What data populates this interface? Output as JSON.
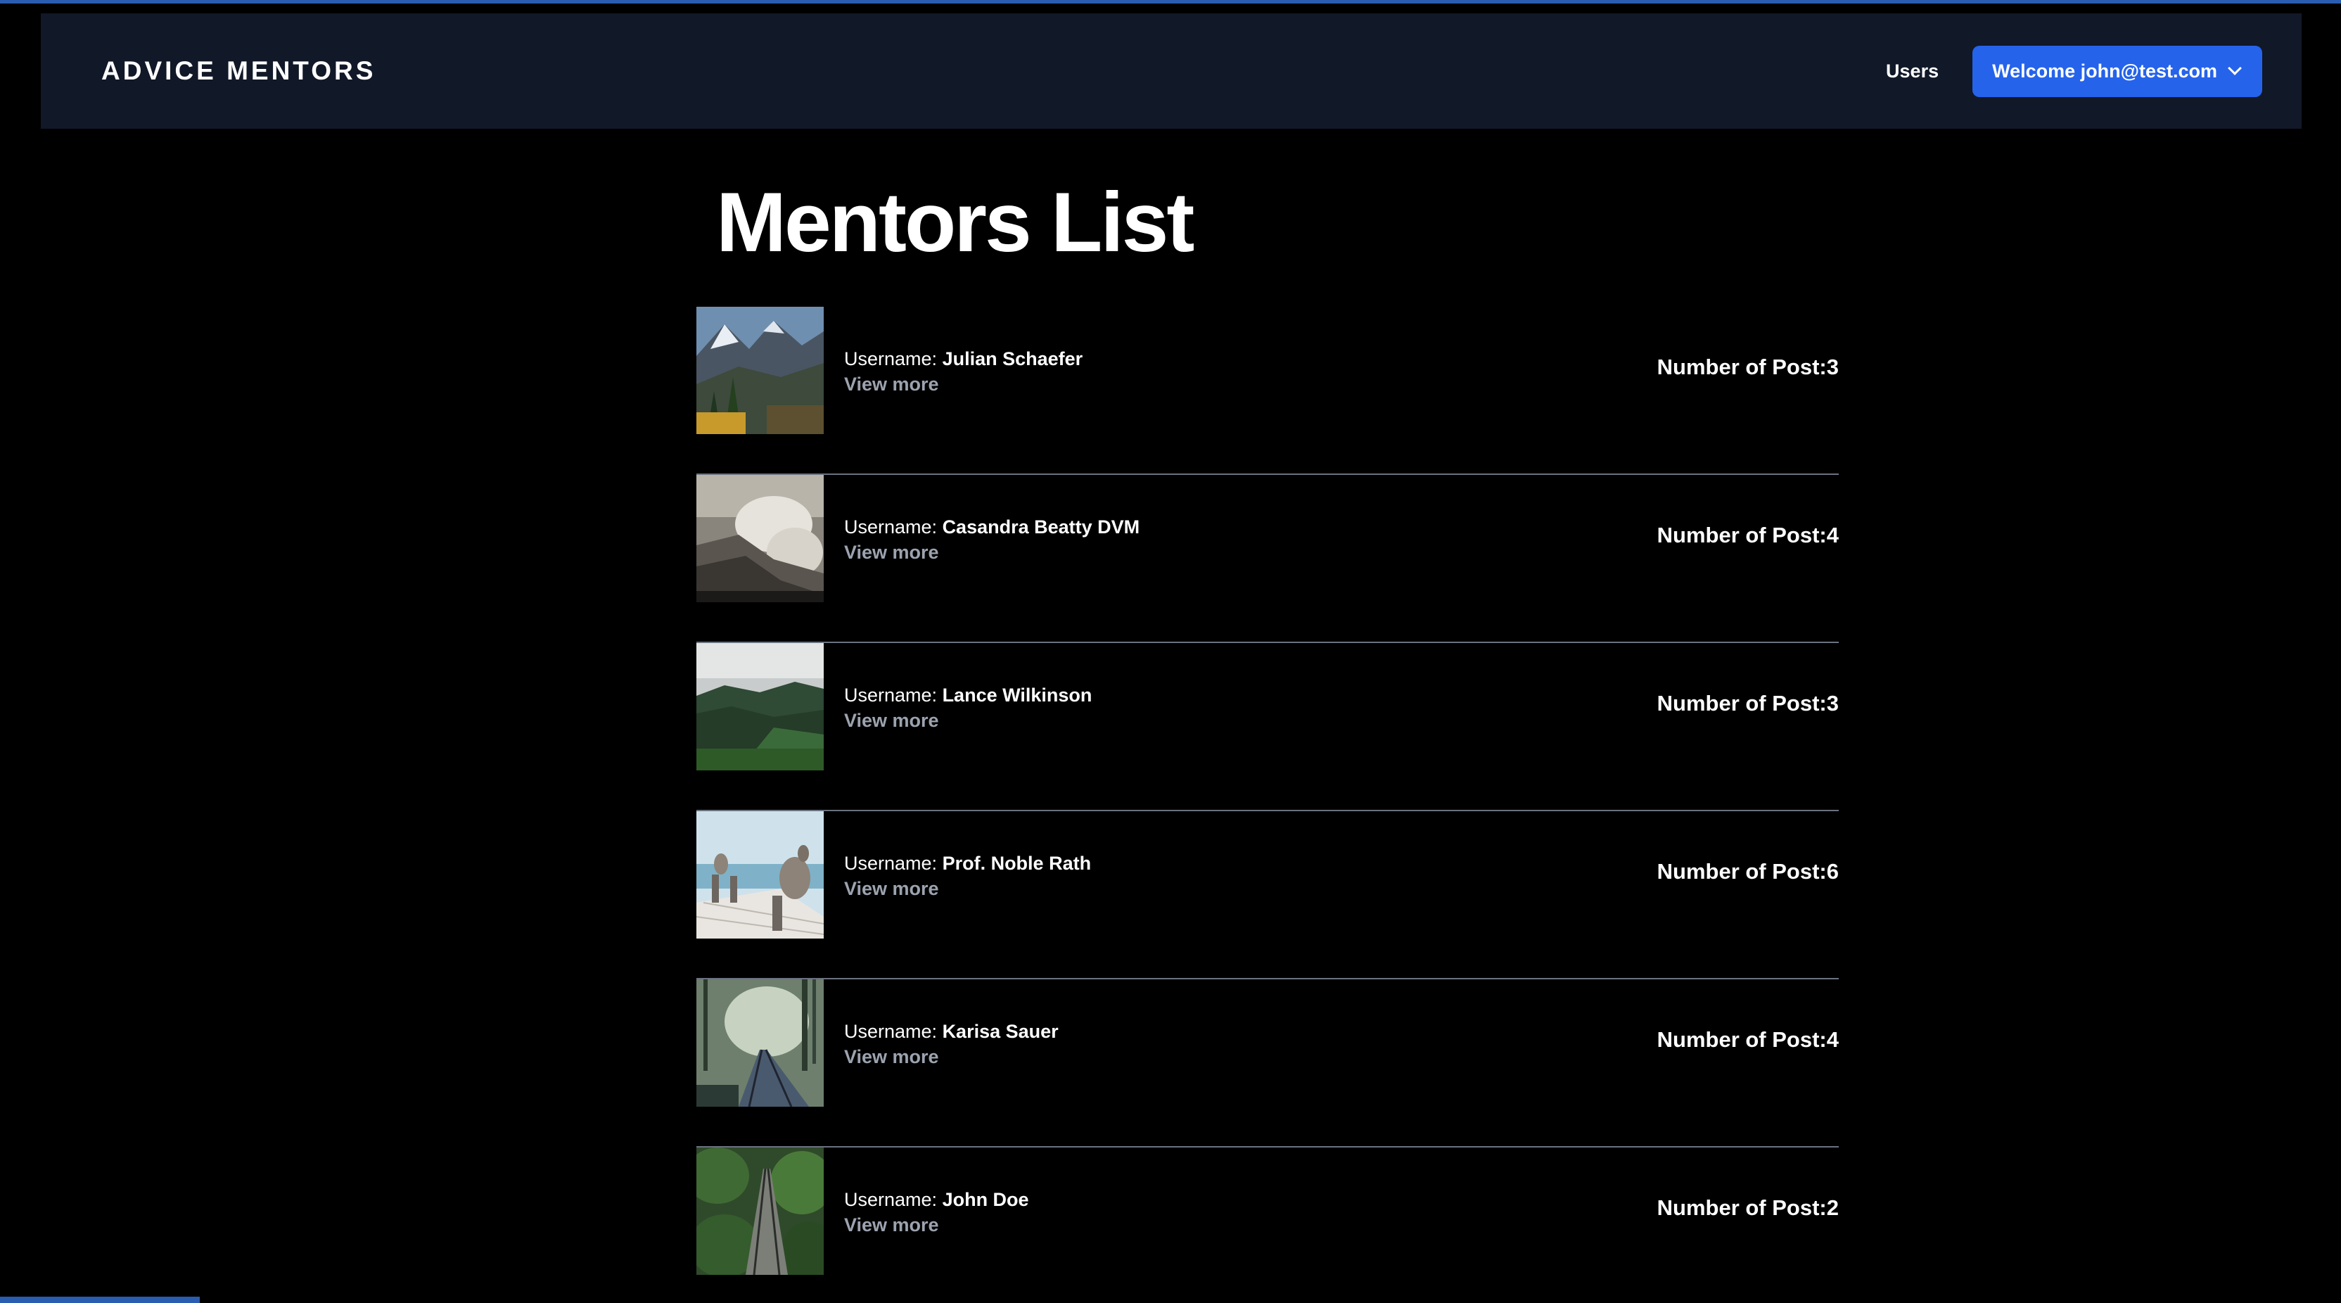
{
  "nav": {
    "brand": "ADVICE MENTORS",
    "users_link": "Users",
    "welcome_button": "Welcome john@test.com"
  },
  "page_title": "Mentors List",
  "mentors": [
    {
      "username_label": "Username: ",
      "username": "Julian Schaefer",
      "view_more": "View more",
      "posts_label": "Number of Post:",
      "posts": "3",
      "thumb": "mountain-valley"
    },
    {
      "username_label": "Username: ",
      "username": "Casandra Beatty DVM",
      "view_more": "View more",
      "posts_label": "Number of Post:",
      "posts": "4",
      "thumb": "waterfall-mist"
    },
    {
      "username_label": "Username: ",
      "username": "Lance Wilkinson",
      "view_more": "View more",
      "posts_label": "Number of Post:",
      "posts": "3",
      "thumb": "foggy-hills"
    },
    {
      "username_label": "Username: ",
      "username": "Prof. Noble Rath",
      "view_more": "View more",
      "posts_label": "Number of Post:",
      "posts": "6",
      "thumb": "pelican-pier"
    },
    {
      "username_label": "Username: ",
      "username": "Karisa Sauer",
      "view_more": "View more",
      "posts_label": "Number of Post:",
      "posts": "4",
      "thumb": "forest-railway"
    },
    {
      "username_label": "Username: ",
      "username": "John Doe",
      "view_more": "View more",
      "posts_label": "Number of Post:",
      "posts": "2",
      "thumb": "jungle-tracks"
    }
  ],
  "colors": {
    "background": "#000000",
    "navbar": "#111827",
    "accent": "#2563eb",
    "muted_text": "#9ca3af",
    "divider": "#6b7280"
  }
}
